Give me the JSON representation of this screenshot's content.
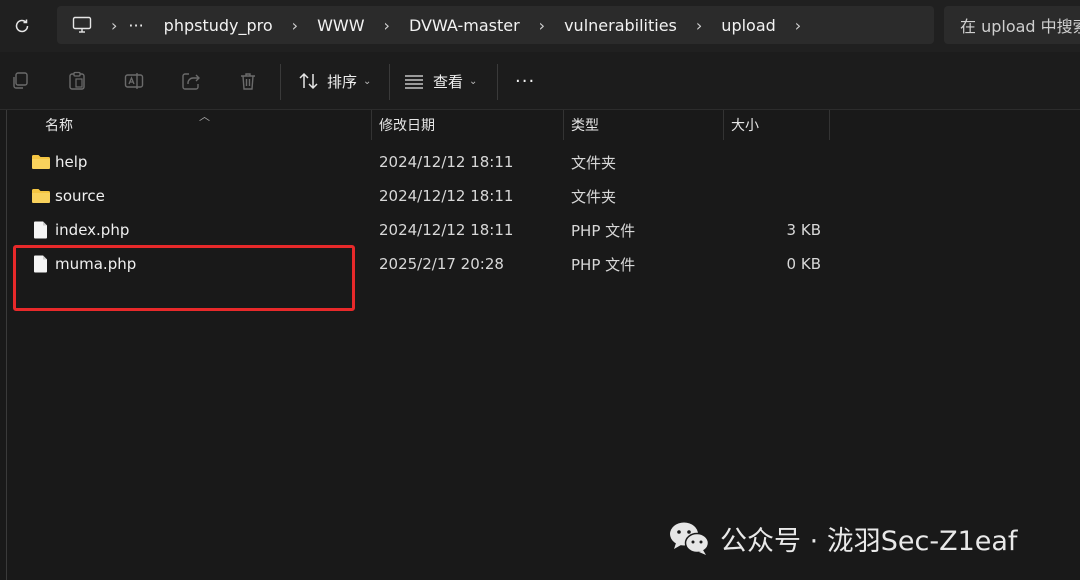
{
  "address_bar": {
    "overflow": "···",
    "crumbs": [
      "phpstudy_pro",
      "WWW",
      "DVWA-master",
      "vulnerabilities",
      "upload"
    ]
  },
  "search": {
    "placeholder": "在 upload 中搜索"
  },
  "toolbar": {
    "sort_label": "排序",
    "view_label": "查看",
    "more": "···"
  },
  "columns": {
    "name": "名称",
    "modified": "修改日期",
    "type": "类型",
    "size": "大小"
  },
  "files": [
    {
      "name": "help",
      "modified": "2024/12/12 18:11",
      "type": "文件夹",
      "size": "",
      "kind": "folder"
    },
    {
      "name": "source",
      "modified": "2024/12/12 18:11",
      "type": "文件夹",
      "size": "",
      "kind": "folder"
    },
    {
      "name": "index.php",
      "modified": "2024/12/12 18:11",
      "type": "PHP 文件",
      "size": "3 KB",
      "kind": "file"
    },
    {
      "name": "muma.php",
      "modified": "2025/2/17 20:28",
      "type": "PHP 文件",
      "size": "0 KB",
      "kind": "file"
    }
  ],
  "watermark": {
    "text": "公众号 · 泷羽Sec-Z1eaf"
  },
  "colors": {
    "highlight": "#e8292a",
    "folder": "#f4c542"
  }
}
